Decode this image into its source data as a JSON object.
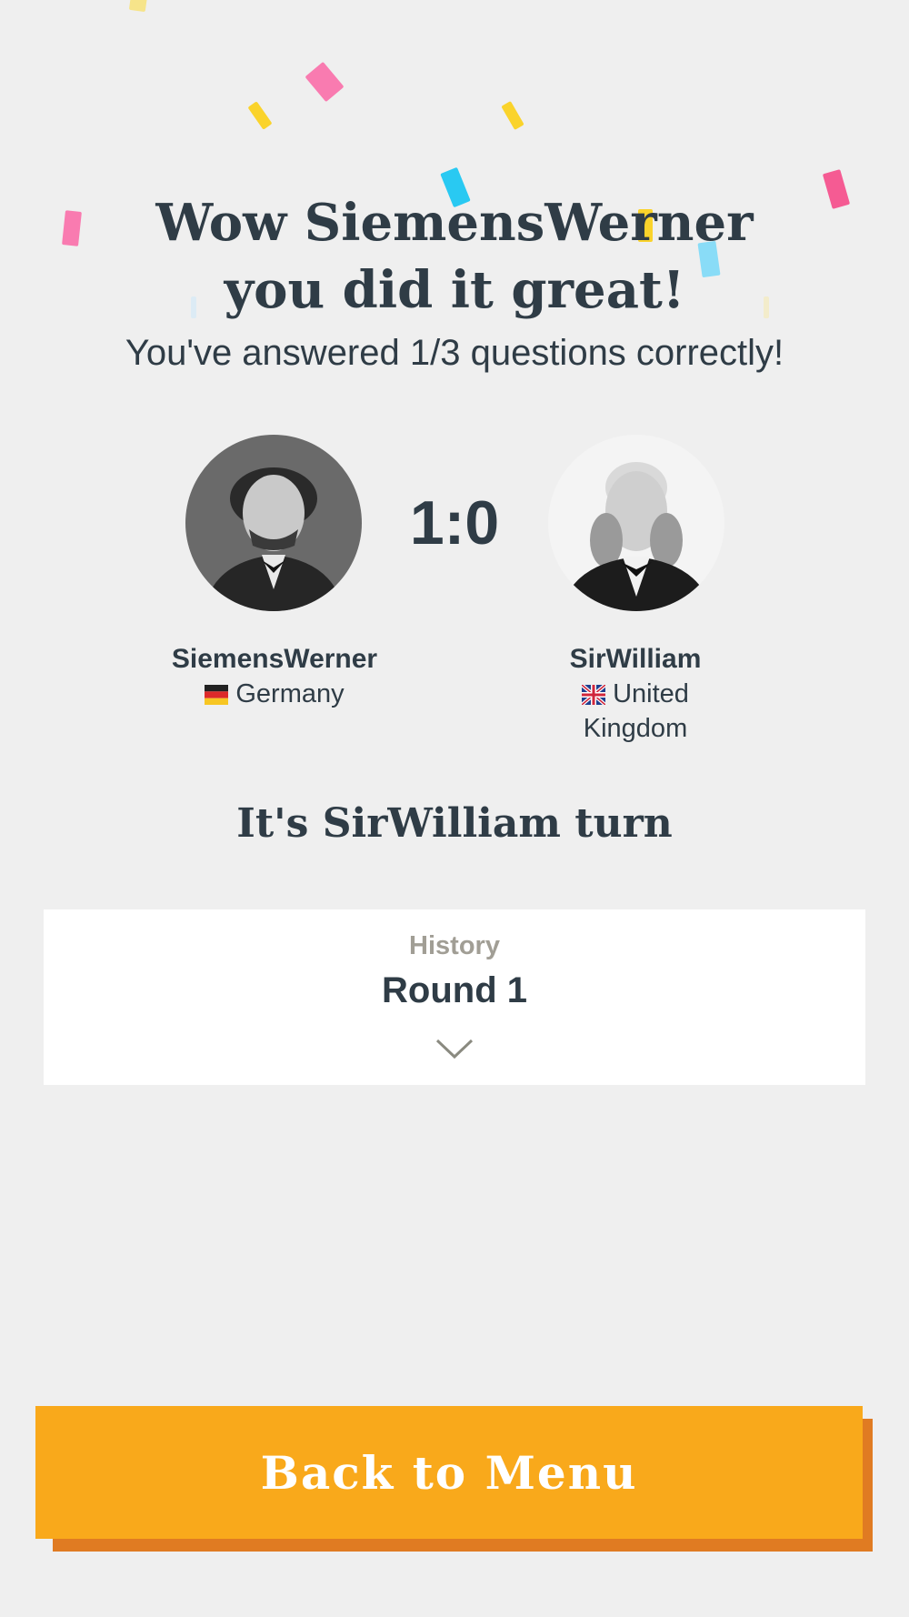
{
  "result": {
    "headline_line1": "Wow SiemensWerner",
    "headline_line2": "you did it great!",
    "summary": "You've answered 1/3 questions correctly!"
  },
  "match": {
    "score": "1:0",
    "player1": {
      "name": "SiemensWerner",
      "country": "Germany",
      "flag_icon": "germany-flag-icon"
    },
    "player2": {
      "name": "SirWilliam",
      "country_line1": "United",
      "country_line2": "Kingdom",
      "flag_icon": "uk-flag-icon"
    },
    "turn_text": "It's SirWilliam turn"
  },
  "history": {
    "category": "History",
    "round": "Round 1",
    "expand_icon": "chevron-down-icon"
  },
  "actions": {
    "back_label": "Back to Menu"
  },
  "colors": {
    "background": "#efefef",
    "text": "#2f3c46",
    "muted": "#a19e95",
    "button": "#f9a91b",
    "button_shadow": "#e07b22",
    "confetti": [
      "#f97bb0",
      "#fad32b",
      "#29c9f2",
      "#89dcf7",
      "#f55b93"
    ]
  }
}
